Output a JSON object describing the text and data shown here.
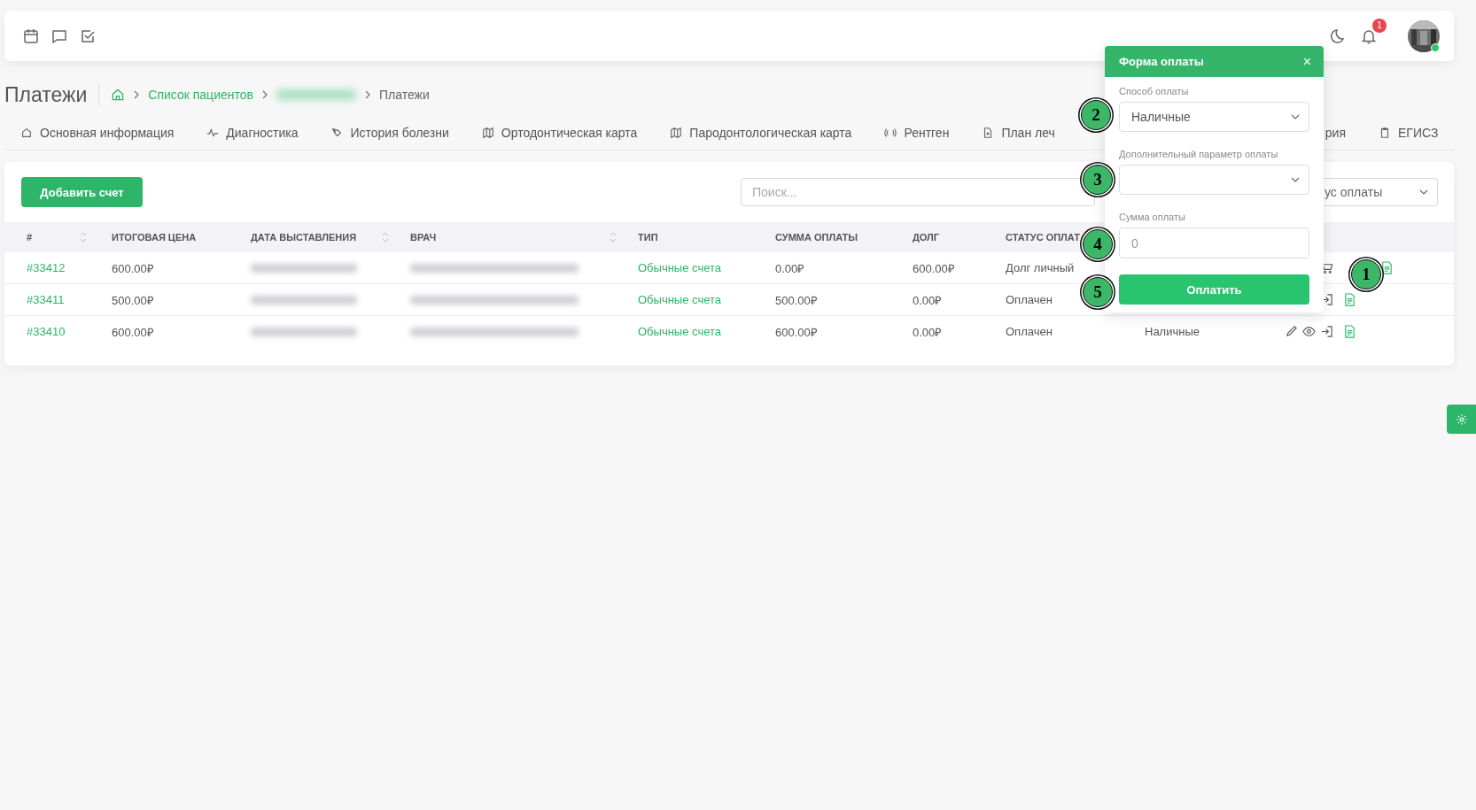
{
  "header": {
    "notifications": "1"
  },
  "page": {
    "title": "Платежи",
    "breadcrumbs": [
      {
        "label": "Список пациентов",
        "kind": "link"
      },
      {
        "label": "Платежи",
        "kind": "current"
      }
    ]
  },
  "tabs": [
    {
      "label": "Основная информация"
    },
    {
      "label": "Диагностика"
    },
    {
      "label": "История болезни"
    },
    {
      "label": "Ортодонтическая карта"
    },
    {
      "label": "Пародонтологическая карта"
    },
    {
      "label": "Рентген"
    },
    {
      "label": "План леч"
    },
    {
      "label": "рия"
    },
    {
      "label": "ЕГИСЗ"
    }
  ],
  "toolbar": {
    "add_button": "Добавить счет",
    "search": {
      "placeholder": "Поиск..."
    },
    "status_filter": "ус оплаты"
  },
  "table": {
    "columns": [
      {
        "label": "#",
        "sortable": true
      },
      {
        "label": "ИТОГОВАЯ ЦЕНА",
        "sortable": false
      },
      {
        "label": "ДАТА ВЫСТАВЛЕНИЯ",
        "sortable": true
      },
      {
        "label": "ВРАЧ",
        "sortable": true
      },
      {
        "label": "ТИП",
        "sortable": false
      },
      {
        "label": "СУММА ОПЛАТЫ",
        "sortable": false
      },
      {
        "label": "ДОЛГ",
        "sortable": false
      },
      {
        "label": "СТАТУС ОПЛАТ"
      }
    ],
    "rows": [
      {
        "id": "#33412",
        "total": "600.00₽",
        "type": "Обычные счета",
        "paid": "0.00₽",
        "debt": "600.00₽",
        "status": "Долг личный",
        "actions": [
          {
            "kind": "cart"
          },
          {
            "kind": "doc"
          }
        ]
      },
      {
        "id": "#33411",
        "total": "500.00₽",
        "type": "Обычные счета",
        "paid": "500.00₽",
        "debt": "0.00₽",
        "status": "Оплачен",
        "actions": [
          {
            "kind": "login"
          },
          {
            "kind": "doc"
          }
        ]
      },
      {
        "id": "#33410",
        "total": "600.00₽",
        "type": "Обычные счета",
        "paid": "600.00₽",
        "debt": "0.00₽",
        "status": "Оплачен",
        "method": "Наличные",
        "actions": [
          {
            "kind": "edit"
          },
          {
            "kind": "view"
          },
          {
            "kind": "login"
          },
          {
            "kind": "doc"
          }
        ]
      }
    ]
  },
  "payment_form": {
    "title": "Форма оплаты",
    "close": "×",
    "method_label": "Способ оплаты",
    "method_value": "Наличные",
    "extra_label": "Дополнительный параметр оплаты",
    "amount_label": "Сумма оплаты",
    "amount_placeholder": "0",
    "submit": "Оплатить"
  },
  "callouts": [
    {
      "label": "1"
    },
    {
      "label": "2"
    },
    {
      "label": "3"
    },
    {
      "label": "4"
    },
    {
      "label": "5"
    }
  ]
}
